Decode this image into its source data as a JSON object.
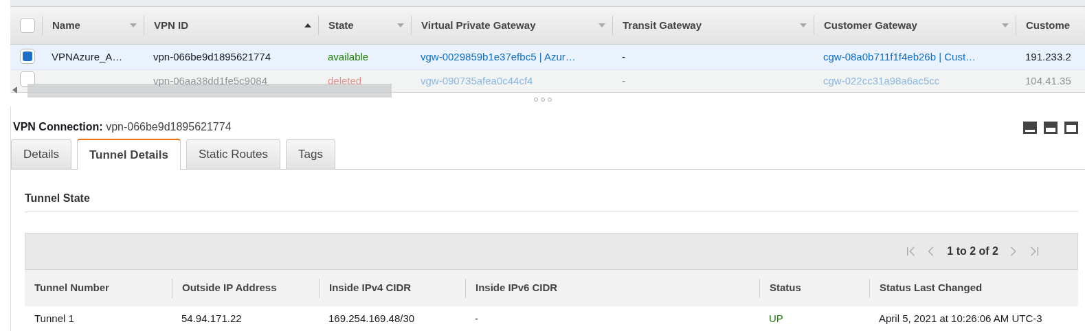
{
  "connections_table": {
    "select_all": {
      "checked": false
    },
    "columns": [
      {
        "label": "Name",
        "sortable": true,
        "sorted": false
      },
      {
        "label": "VPN ID",
        "sortable": true,
        "sorted": true
      },
      {
        "label": "State",
        "sortable": true,
        "sorted": false
      },
      {
        "label": "Virtual Private Gateway",
        "sortable": true,
        "sorted": false
      },
      {
        "label": "Transit Gateway",
        "sortable": true,
        "sorted": false
      },
      {
        "label": "Customer Gateway",
        "sortable": true,
        "sorted": false
      },
      {
        "label": "Custome",
        "sortable": false
      }
    ],
    "rows": [
      {
        "selected": true,
        "disabled": false,
        "name": "VPNAzure_A…",
        "vpn_id": "vpn-066be9d1895621774",
        "state": "available",
        "color": "#1d8102",
        "virtual_private_gateway": "vgw-0029859b1e37efbc5 | Azur…",
        "transit_gateway": "-",
        "customer_gateway": "cgw-08a0b711f1f4eb26b | Cust…",
        "column_7": "191.233.2"
      },
      {
        "selected": false,
        "disabled": true,
        "vpn_id": "vpn-06aa38dd1fe5c9084",
        "state": "deleted",
        "color": "#e3908a",
        "virtual_private_gateway": "vgw-090735afea0c44cf4",
        "transit_gateway": "-",
        "customer_gateway": "cgw-022cc31a98a6ac5cc",
        "column_7": "104.41.35"
      }
    ]
  },
  "details": {
    "label": "VPN Connection:",
    "value": "vpn-066be9d1895621774",
    "tabs": [
      {
        "label": "Details",
        "selected": false
      },
      {
        "label": "Tunnel Details",
        "selected": true
      },
      {
        "label": "Static Routes",
        "selected": false
      },
      {
        "label": "Tags",
        "selected": false
      }
    ],
    "section_title": "Tunnel State",
    "pager": {
      "range": "1 to 2 of 2"
    },
    "tunnels_table": {
      "columns": [
        "Tunnel Number",
        "Outside IP Address",
        "Inside IPv4 CIDR",
        "Inside IPv6 CIDR",
        "Status",
        "Status Last Changed"
      ],
      "rows": [
        {
          "tunnel_number": "Tunnel 1",
          "outside_ip": "54.94.171.22",
          "inside_ipv4": "169.254.169.48/30",
          "inside_ipv6": "-",
          "status": "UP",
          "color": "#1d8102",
          "last_changed": "April 5, 2021 at 10:26:06 AM UTC-3"
        }
      ]
    }
  }
}
